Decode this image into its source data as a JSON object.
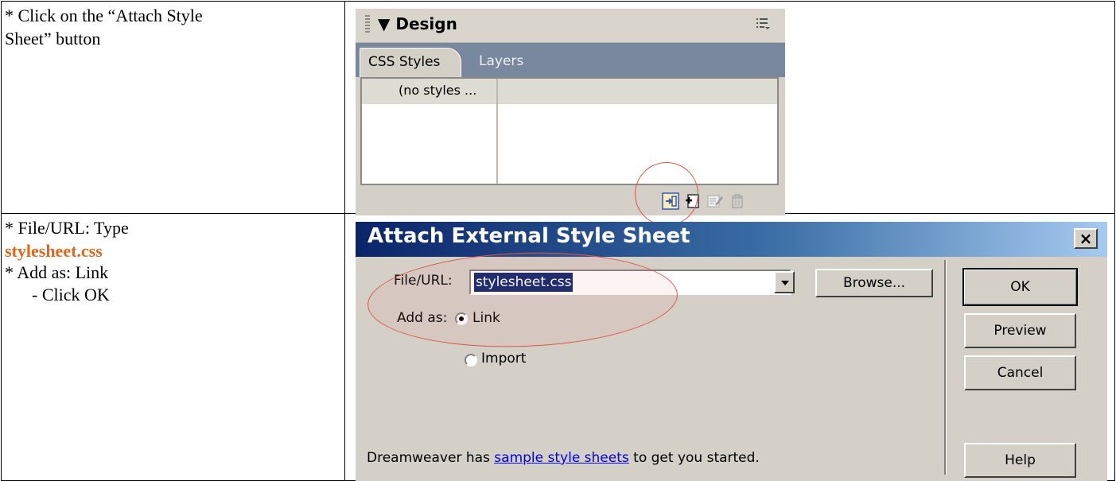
{
  "instructions": {
    "row1_line1": "* Click on the “Attach Style",
    "row1_line2": "Sheet” button",
    "row2_line1": "* File/URL: Type",
    "row2_filename": "stylesheet.css",
    "row2_line3": "* Add as: Link",
    "row2_line4": "- Click OK"
  },
  "design_panel": {
    "title": "▼ Design",
    "tabs": [
      "CSS Styles",
      "Layers"
    ],
    "styles_placeholder": "(no styles ...",
    "footer_icons": [
      "attach-style-sheet-icon",
      "new-css-style-icon",
      "edit-style-icon",
      "delete-style-icon"
    ]
  },
  "dialog": {
    "title": "Attach External Style Sheet",
    "close_label": "×",
    "file_url_label": "File/URL:",
    "file_url_value": "stylesheet.css",
    "add_as_label": "Add as:",
    "options": [
      "Link",
      "Import"
    ],
    "selected_option": "Link",
    "buttons": {
      "browse": "Browse...",
      "ok": "OK",
      "preview": "Preview",
      "cancel": "Cancel",
      "help": "Help"
    },
    "footer_prefix": "Dreamweaver has ",
    "footer_link": "sample style sheets",
    "footer_suffix": " to get you started."
  },
  "colors": {
    "accent_orange": "#e3661b",
    "titlebar_start": "#0a246a",
    "titlebar_end": "#a6caf0",
    "dialog_bg": "#d4d0c8",
    "tab_bar": "#7a889f",
    "highlight_circle": "#d9584b"
  }
}
